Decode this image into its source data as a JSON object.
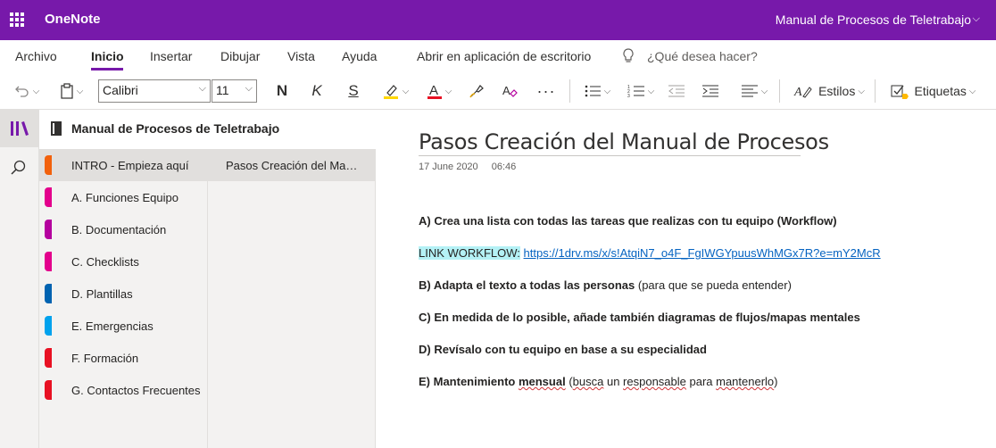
{
  "titlebar": {
    "app_name": "OneNote",
    "notebook_title": "Manual de Procesos de Teletrabajo",
    "bg_color": "#7719aa"
  },
  "tabs": [
    {
      "label": "Archivo"
    },
    {
      "label": "Inicio",
      "active": true
    },
    {
      "label": "Insertar"
    },
    {
      "label": "Dibujar"
    },
    {
      "label": "Vista"
    },
    {
      "label": "Ayuda"
    },
    {
      "label": "Abrir en aplicación de escritorio"
    }
  ],
  "tell_me": {
    "placeholder": "¿Qué desea hacer?",
    "icon": "lightbulb-icon"
  },
  "toolbar": {
    "font_name": "Calibri",
    "font_size": "11",
    "bold": "N",
    "italic": "K",
    "underline": "S",
    "styles_label": "Estilos",
    "tags_label": "Etiquetas",
    "highlight_color": "#ffd700",
    "font_color": "#e81123"
  },
  "notebook": {
    "name": "Manual de Procesos de Teletrabajo"
  },
  "sections": [
    {
      "label": "INTRO - Empieza aquí",
      "color": "#f2610c",
      "active": true
    },
    {
      "label": "A. Funciones Equipo",
      "color": "#e3008c"
    },
    {
      "label": "B. Documentación",
      "color": "#b4009e"
    },
    {
      "label": "C. Checklists",
      "color": "#e3008c"
    },
    {
      "label": "D. Plantillas",
      "color": "#0063b1"
    },
    {
      "label": "E. Emergencias",
      "color": "#00a2ed"
    },
    {
      "label": "F. Formación",
      "color": "#e81123"
    },
    {
      "label": "G. Contactos Frecuentes",
      "color": "#e81123"
    }
  ],
  "pages": [
    {
      "label": "Pasos Creación del Manual de Procesos"
    }
  ],
  "page": {
    "title": "Pasos Creación del Manual de Procesos",
    "date": "17 June 2020",
    "time": "06:46",
    "p1": "A) Crea una lista con todas las tareas que realizas con tu equipo (Workflow)",
    "link_label": "LINK WORKFLOW:",
    "link_url": "https://1drv.ms/x/s!AtqiN7_o4F_FgIWGYpuusWhMGx7R?e=mY2McR",
    "p3_bold": "B) Adapta el texto a todas las personas",
    "p3_rest": " (para que se pueda entender)",
    "p4": "C) En medida de lo posible, añade también diagramas de flujos/mapas mentales",
    "p5": "D) Revísalo con tu equipo en base a su especialidad",
    "p6_a": "E) Mantenimiento ",
    "p6_b": "mensual",
    "p6_c": " (",
    "p6_d": "busca",
    "p6_e": " un ",
    "p6_f": "responsable",
    "p6_g": " para ",
    "p6_h": "mantenerlo",
    "p6_i": ")"
  }
}
